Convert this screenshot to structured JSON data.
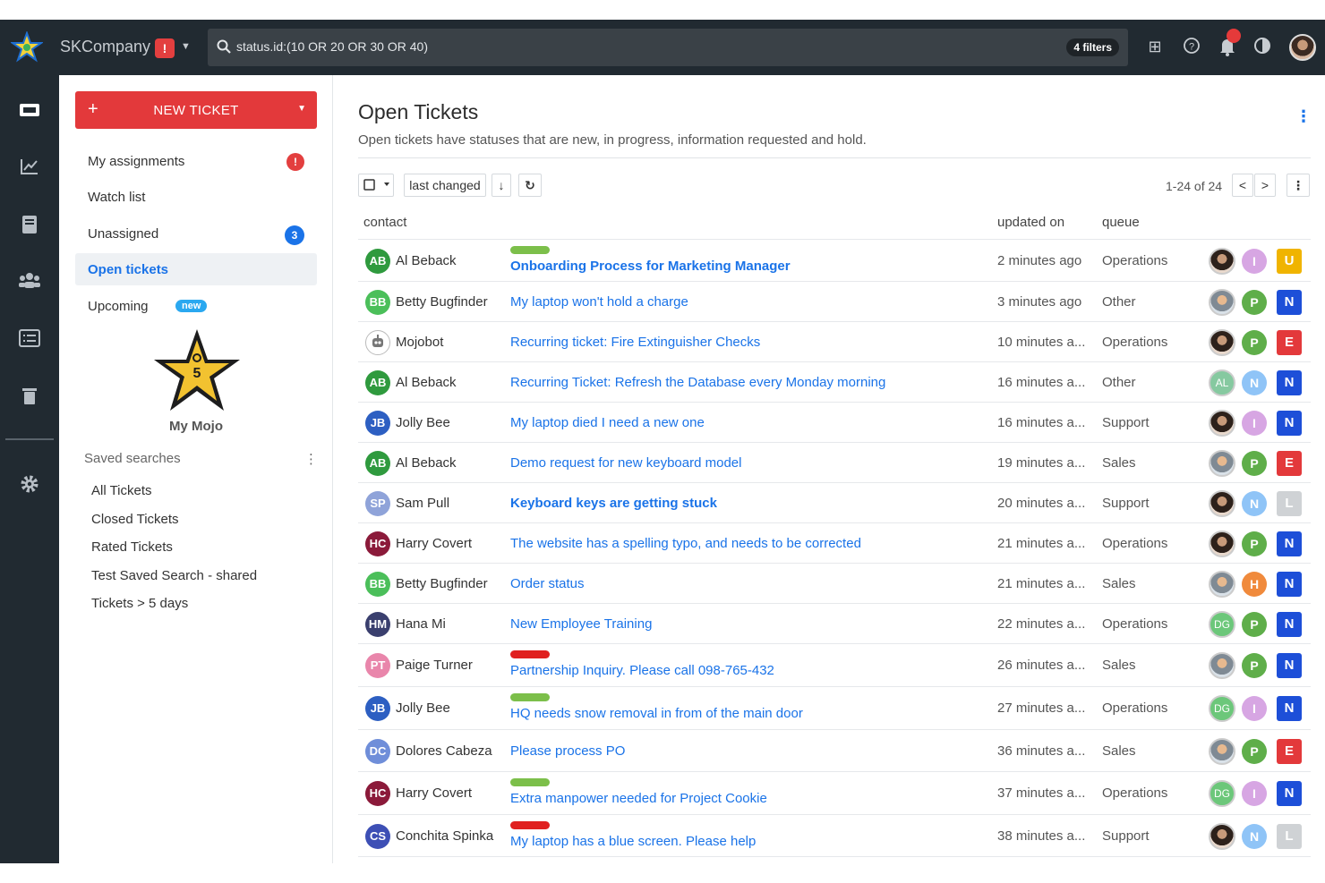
{
  "topbar": {
    "company": "SKCompany",
    "company_alert": "!",
    "search_query": "status.id:(10 OR 20 OR 30 OR 40)",
    "filters_badge": "4 filters"
  },
  "rail": {
    "icons": [
      "ticket-icon",
      "chart-icon",
      "book-icon",
      "people-icon",
      "list-icon",
      "trash-icon",
      "settings-icon"
    ]
  },
  "sidebar": {
    "new_ticket_plus": "+",
    "new_ticket_label": "NEW TICKET",
    "nav": {
      "my_assignments": "My assignments",
      "my_assignments_badge": "!",
      "watch_list": "Watch list",
      "unassigned": "Unassigned",
      "unassigned_count": "3",
      "open_tickets": "Open tickets",
      "upcoming": "Upcoming",
      "upcoming_badge": "new"
    },
    "mojo": {
      "level": "5",
      "label": "My Mojo"
    },
    "saved_searches_title": "Saved searches",
    "saved_searches_menu": "⋮",
    "saved_searches": [
      "All Tickets",
      "Closed Tickets",
      "Rated Tickets",
      "Test Saved Search - shared",
      "Tickets > 5 days"
    ]
  },
  "main": {
    "title": "Open Tickets",
    "subtitle": "Open tickets have statuses that are new, in progress, information requested and hold.",
    "menu": "⋮",
    "sort_label": "last changed",
    "sort_direction": "↓",
    "refresh": "↻",
    "pagination": "1-24 of 24",
    "prev": "<",
    "next": ">",
    "more": "⋮",
    "columns": {
      "contact": "contact",
      "updated": "updated on",
      "queue": "queue"
    }
  },
  "tickets": [
    {
      "initials": "AB",
      "contact": "Al Beback",
      "subject": "Onboarding Process for Marketing Manager",
      "bold": true,
      "tag": "#7cbf4a",
      "updated": "2 minutes ago",
      "queue": "Operations",
      "group": "I",
      "group_color": "#d7a6e3",
      "priority": "U",
      "priority_color": "#f0b400"
    },
    {
      "initials": "BB",
      "contact": "Betty Bugfinder",
      "subject": "My laptop won't hold a charge",
      "bold": false,
      "tag": "",
      "updated": "3 minutes ago",
      "queue": "Other",
      "group": "P",
      "group_color": "#5fae4a",
      "priority": "N",
      "priority_color": "#1d4fd8"
    },
    {
      "initials": "",
      "contact": "Mojobot",
      "subject": "Recurring ticket: Fire Extinguisher Checks",
      "bold": false,
      "tag": "",
      "updated": "10 minutes a...",
      "queue": "Operations",
      "group": "P",
      "group_color": "#5fae4a",
      "priority": "E",
      "priority_color": "#e3393b"
    },
    {
      "initials": "AB",
      "contact": "Al Beback",
      "subject": "Recurring Ticket: Refresh the Database every Monday morning",
      "bold": false,
      "tag": "",
      "updated": "16 minutes a...",
      "queue": "Other",
      "group": "N",
      "group_color": "#8fc4f7",
      "priority": "N",
      "priority_color": "#1d4fd8"
    },
    {
      "initials": "JB",
      "contact": "Jolly Bee",
      "subject": "My laptop died I need a new one",
      "bold": false,
      "tag": "",
      "updated": "16 minutes a...",
      "queue": "Support",
      "group": "I",
      "group_color": "#d7a6e3",
      "priority": "N",
      "priority_color": "#1d4fd8"
    },
    {
      "initials": "AB",
      "contact": "Al Beback",
      "subject": "Demo request for new keyboard model",
      "bold": false,
      "tag": "",
      "updated": "19 minutes a...",
      "queue": "Sales",
      "group": "P",
      "group_color": "#5fae4a",
      "priority": "E",
      "priority_color": "#e3393b"
    },
    {
      "initials": "SP",
      "contact": "Sam Pull",
      "subject": "Keyboard keys are getting stuck",
      "bold": true,
      "tag": "",
      "updated": "20 minutes a...",
      "queue": "Support",
      "group": "N",
      "group_color": "#8fc4f7",
      "priority": "L",
      "priority_color": "#cfd2d5"
    },
    {
      "initials": "HC",
      "contact": "Harry Covert",
      "subject": "The website has a spelling typo, and needs to be corrected",
      "bold": false,
      "tag": "",
      "updated": "21 minutes a...",
      "queue": "Operations",
      "group": "P",
      "group_color": "#5fae4a",
      "priority": "N",
      "priority_color": "#1d4fd8"
    },
    {
      "initials": "BB",
      "contact": "Betty Bugfinder",
      "subject": "Order status",
      "bold": false,
      "tag": "",
      "updated": "21 minutes a...",
      "queue": "Sales",
      "group": "H",
      "group_color": "#f08a3c",
      "priority": "N",
      "priority_color": "#1d4fd8"
    },
    {
      "initials": "HM",
      "contact": "Hana Mi",
      "subject": "New Employee Training",
      "bold": false,
      "tag": "",
      "updated": "22 minutes a...",
      "queue": "Operations",
      "group": "P",
      "group_color": "#5fae4a",
      "priority": "N",
      "priority_color": "#1d4fd8"
    },
    {
      "initials": "PT",
      "contact": "Paige Turner",
      "subject": "Partnership Inquiry. Please call 098-765-432",
      "bold": false,
      "tag": "#e0201f",
      "updated": "26 minutes a...",
      "queue": "Sales",
      "group": "P",
      "group_color": "#5fae4a",
      "priority": "N",
      "priority_color": "#1d4fd8"
    },
    {
      "initials": "JB",
      "contact": "Jolly Bee",
      "subject": "HQ needs snow removal in from of the main door",
      "bold": false,
      "tag": "#7cbf4a",
      "updated": "27 minutes a...",
      "queue": "Operations",
      "group": "I",
      "group_color": "#d7a6e3",
      "priority": "N",
      "priority_color": "#1d4fd8"
    },
    {
      "initials": "DC",
      "contact": "Dolores Cabeza",
      "subject": "Please process PO",
      "bold": false,
      "tag": "",
      "updated": "36 minutes a...",
      "queue": "Sales",
      "group": "P",
      "group_color": "#5fae4a",
      "priority": "E",
      "priority_color": "#e3393b"
    },
    {
      "initials": "HC",
      "contact": "Harry Covert",
      "subject": "Extra manpower needed for Project Cookie",
      "bold": false,
      "tag": "#7cbf4a",
      "updated": "37 minutes a...",
      "queue": "Operations",
      "group": "I",
      "group_color": "#d7a6e3",
      "priority": "N",
      "priority_color": "#1d4fd8"
    },
    {
      "initials": "CS",
      "contact": "Conchita Spinka",
      "subject": "My laptop has a blue screen. Please help",
      "bold": false,
      "tag": "#e0201f",
      "updated": "38 minutes a...",
      "queue": "Support",
      "group": "N",
      "group_color": "#8fc4f7",
      "priority": "L",
      "priority_color": "#cfd2d5"
    }
  ],
  "assignees": [
    {
      "initials": "",
      "style": "dark"
    },
    {
      "initials": "",
      "style": "light"
    },
    {
      "initials": "",
      "style": "dark"
    },
    {
      "initials": "AL",
      "style": "mint"
    },
    {
      "initials": "",
      "style": "dark"
    },
    {
      "initials": "",
      "style": "light"
    },
    {
      "initials": "",
      "style": "dark"
    },
    {
      "initials": "",
      "style": "dark"
    },
    {
      "initials": "",
      "style": "light"
    },
    {
      "initials": "DG",
      "style": "green"
    },
    {
      "initials": "",
      "style": "light"
    },
    {
      "initials": "DG",
      "style": "green"
    },
    {
      "initials": "",
      "style": "light"
    },
    {
      "initials": "DG",
      "style": "green"
    },
    {
      "initials": "",
      "style": "dark"
    }
  ],
  "contact_colors": {
    "AB": "#2f9a3e",
    "BB": "#4bbf5a",
    "JB": "#2d5fc2",
    "SP": "#8fa3d9",
    "HC": "#8b1a3a",
    "HM": "#3a3f6e",
    "PT": "#e986ab",
    "DC": "#6f8ed9",
    "CS": "#3d4fb5"
  }
}
